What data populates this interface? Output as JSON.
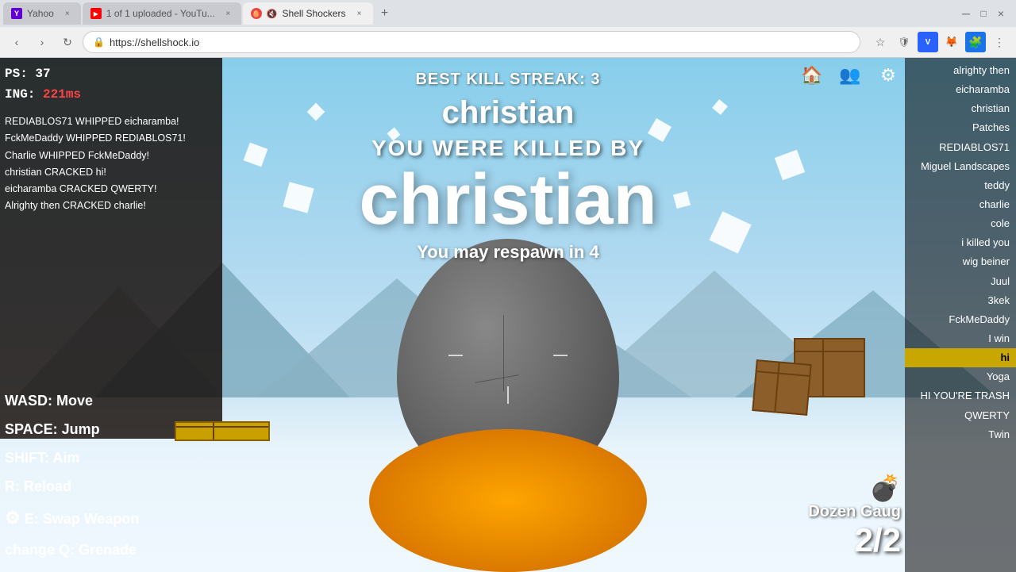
{
  "browser": {
    "tabs": [
      {
        "id": "tab-yahoo",
        "label": "Yahoo",
        "favicon": "Y",
        "active": false
      },
      {
        "id": "tab-yt",
        "label": "1 of 1 uploaded - YouTu...",
        "favicon": "▶",
        "active": false
      },
      {
        "id": "tab-game",
        "label": "Shell Shockers",
        "favicon": "🥚",
        "active": true
      }
    ],
    "address": "https://shellshock.io",
    "nav": {
      "back": "‹",
      "forward": "›",
      "refresh": "↻"
    }
  },
  "game": {
    "kill_streak": "BEST KILL STREAK: 3",
    "killer_name_small": "christian",
    "killed_by_text": "YOU WERE KILLED BY",
    "killer_name_large": "christian",
    "respawn_text": "You may respawn in 4",
    "hud": {
      "ps": "PS: 37",
      "ping_label": "ING:",
      "ping_value": "221ms"
    },
    "chat": [
      "REDIABLOS71 WHIPPED eicharamba!",
      "FckMeDaddy WHIPPED REDIABLOS71!",
      "Charlie WHIPPED FckMeDaddy!",
      "christian CRACKED hi!",
      "eicharamba CRACKED QWERTY!",
      "Alrighty then CRACKED charlie!"
    ],
    "controls": [
      {
        "key": "WASD:",
        "action": "Move"
      },
      {
        "key": "SPACE:",
        "action": "Jump"
      },
      {
        "key": "SHIFT:",
        "action": "Aim"
      },
      {
        "key": "R:",
        "action": "Reload"
      },
      {
        "key": "E:",
        "action": "Swap Weapon"
      },
      {
        "key": "Q:",
        "action": "Grenade"
      }
    ],
    "players": [
      {
        "name": "alrighty then",
        "highlighted": false
      },
      {
        "name": "eicharamba",
        "highlighted": false
      },
      {
        "name": "christian",
        "highlighted": false
      },
      {
        "name": "Patches",
        "highlighted": false
      },
      {
        "name": "REDIABLOS71",
        "highlighted": false
      },
      {
        "name": "Miguel Landscapes",
        "highlighted": false
      },
      {
        "name": "teddy",
        "highlighted": false
      },
      {
        "name": "charlie",
        "highlighted": false
      },
      {
        "name": "cole",
        "highlighted": false
      },
      {
        "name": "i killed you",
        "highlighted": false
      },
      {
        "name": "wig beiner",
        "highlighted": false
      },
      {
        "name": "Juul",
        "highlighted": false
      },
      {
        "name": "3kek",
        "highlighted": false
      },
      {
        "name": "FckMeDaddy",
        "highlighted": false
      },
      {
        "name": "I win",
        "highlighted": false
      },
      {
        "name": "hi",
        "highlighted": true
      },
      {
        "name": "Yoga",
        "highlighted": false
      },
      {
        "name": "HI YOU'RE TRASH",
        "highlighted": false
      },
      {
        "name": "QWERTY",
        "highlighted": false
      },
      {
        "name": "Twin",
        "highlighted": false
      }
    ],
    "weapon": {
      "name": "Dozen Gaug",
      "ammo": "2/2"
    }
  }
}
